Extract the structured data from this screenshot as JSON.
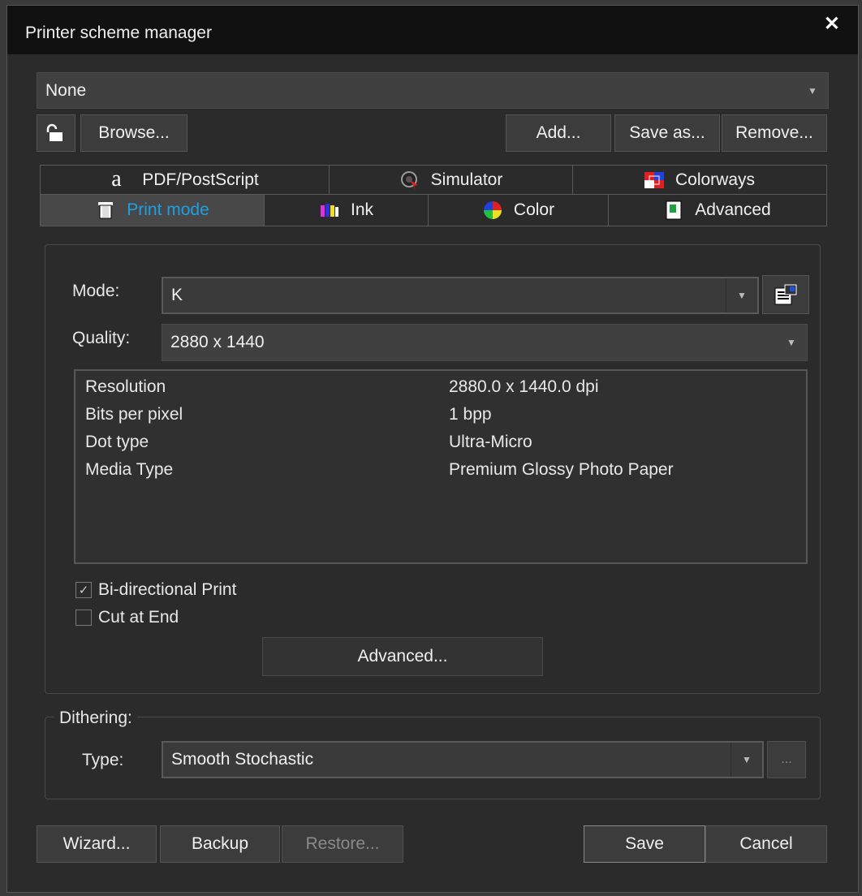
{
  "window": {
    "title": "Printer scheme manager",
    "close_glyph": "✕"
  },
  "scheme": {
    "selected": "None"
  },
  "toolbar": {
    "browse_label": "Browse...",
    "add_label": "Add...",
    "save_as_label": "Save as...",
    "remove_label": "Remove..."
  },
  "tabs": {
    "row1": [
      {
        "label": "PDF/PostScript",
        "icon": "pdf-postscript-icon"
      },
      {
        "label": "Simulator",
        "icon": "simulator-icon"
      },
      {
        "label": "Colorways",
        "icon": "colorways-icon"
      }
    ],
    "row2": [
      {
        "label": "Print mode",
        "icon": "print-mode-icon"
      },
      {
        "label": "Ink",
        "icon": "ink-icon"
      },
      {
        "label": "Color",
        "icon": "color-icon"
      },
      {
        "label": "Advanced",
        "icon": "advanced-icon"
      }
    ],
    "active": "Print mode"
  },
  "print_mode": {
    "mode_label": "Mode:",
    "mode_value": "K",
    "quality_label": "Quality:",
    "quality_value": "2880 x 1440",
    "details": [
      {
        "name": "Resolution",
        "value": "2880.0 x 1440.0 dpi"
      },
      {
        "name": "Bits per pixel",
        "value": "1 bpp"
      },
      {
        "name": "Dot type",
        "value": "Ultra-Micro"
      },
      {
        "name": "Media Type",
        "value": "Premium Glossy Photo Paper"
      }
    ],
    "bidirectional_label": "Bi-directional Print",
    "bidirectional_checked": true,
    "cut_at_end_label": "Cut at End",
    "cut_at_end_checked": false,
    "advanced_button_label": "Advanced..."
  },
  "dithering": {
    "group_label": "Dithering:",
    "type_label": "Type:",
    "type_value": "Smooth Stochastic",
    "ellipsis_label": "..."
  },
  "footer": {
    "wizard_label": "Wizard...",
    "backup_label": "Backup",
    "restore_label": "Restore...",
    "save_label": "Save",
    "cancel_label": "Cancel"
  },
  "colors": {
    "accent": "#1e9fe3",
    "background": "#2b2b2b",
    "titlebar": "#111111"
  }
}
